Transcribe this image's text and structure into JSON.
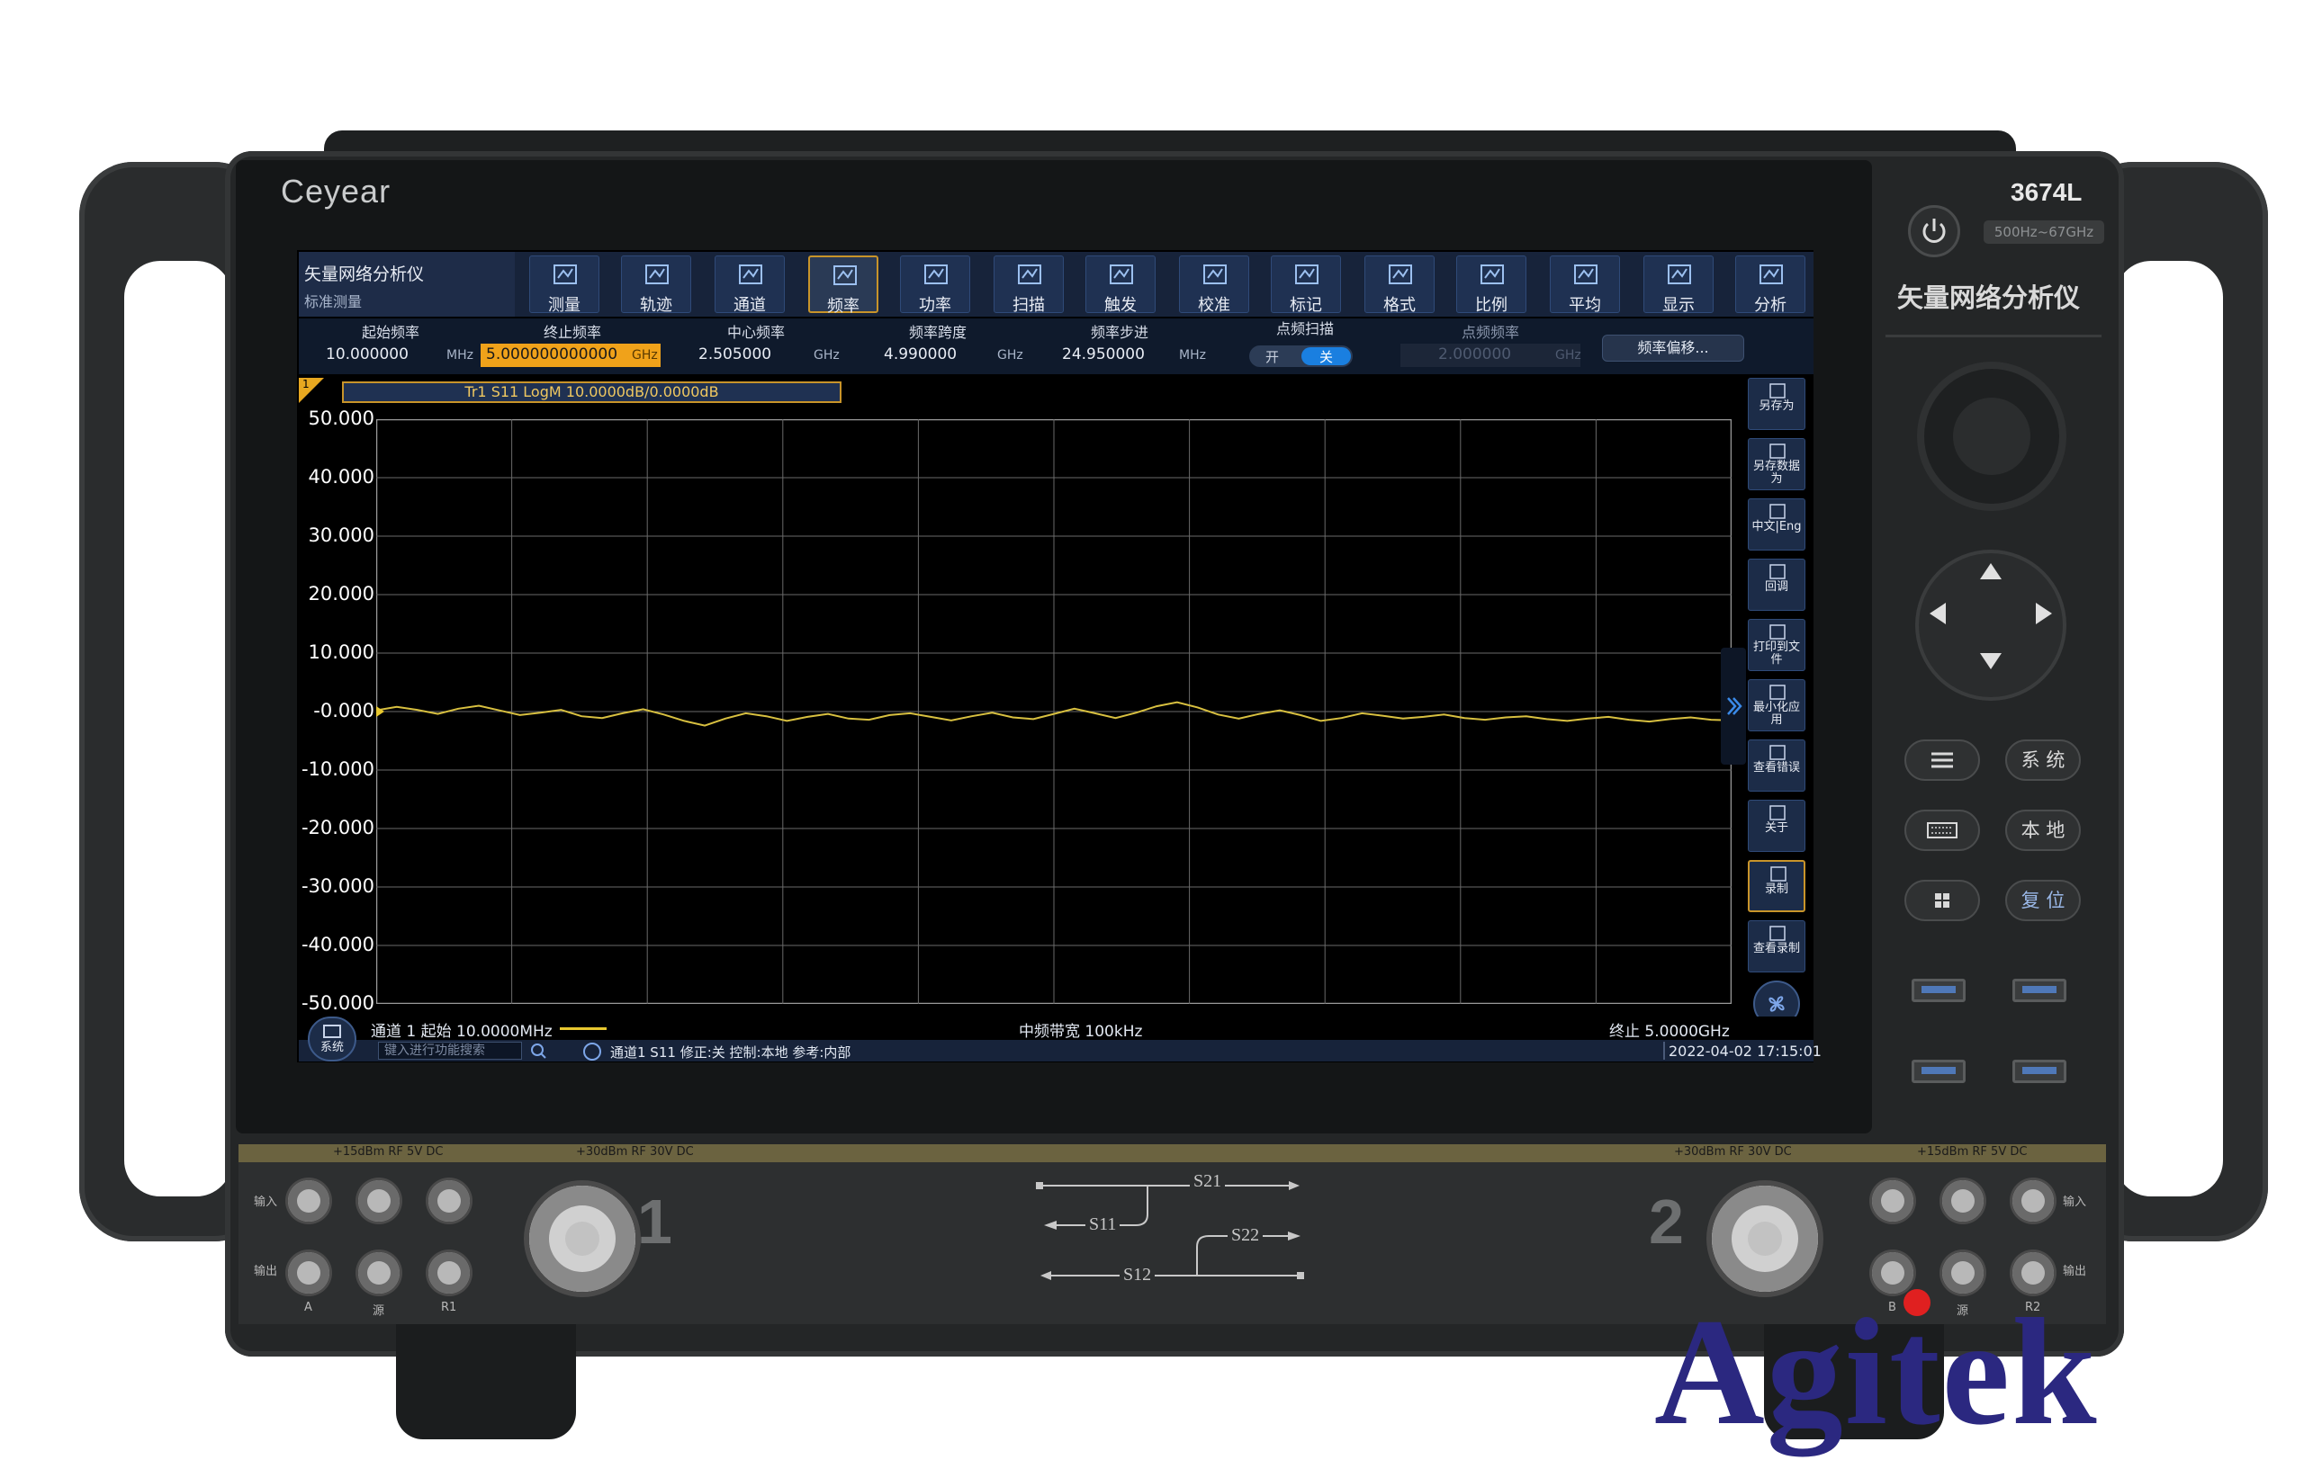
{
  "brand": "Ceyear",
  "model": "3674L",
  "frequency_range_badge": "500Hz~67GHz",
  "panel_title": "矢量网络分析仪",
  "app": {
    "title": "矢量网络分析仪",
    "subtitle": "标准测量"
  },
  "toolbar": [
    {
      "label": "测量",
      "icon": "ruler-icon"
    },
    {
      "label": "轨迹",
      "icon": "trace-icon"
    },
    {
      "label": "通道",
      "icon": "channel-icon"
    },
    {
      "label": "频率",
      "icon": "frequency-icon",
      "active": true
    },
    {
      "label": "功率",
      "icon": "power-icon"
    },
    {
      "label": "扫描",
      "icon": "sweep-icon"
    },
    {
      "label": "触发",
      "icon": "trigger-icon"
    },
    {
      "label": "校准",
      "icon": "calibration-icon"
    },
    {
      "label": "标记",
      "icon": "marker-icon"
    },
    {
      "label": "格式",
      "icon": "format-icon"
    },
    {
      "label": "比例",
      "icon": "scale-icon"
    },
    {
      "label": "平均",
      "icon": "average-icon"
    },
    {
      "label": "显示",
      "icon": "display-icon"
    },
    {
      "label": "分析",
      "icon": "analysis-icon"
    }
  ],
  "freq": {
    "start": {
      "label": "起始频率",
      "value": "10.000000",
      "unit": "MHz"
    },
    "stop": {
      "label": "终止频率",
      "value": "5.000000000000",
      "unit": "GHz"
    },
    "center": {
      "label": "中心频率",
      "value": "2.505000",
      "unit": "GHz"
    },
    "span": {
      "label": "频率跨度",
      "value": "4.990000",
      "unit": "GHz"
    },
    "step": {
      "label": "频率步进",
      "value": "24.950000",
      "unit": "MHz"
    },
    "cw_sweep": {
      "label": "点频扫描",
      "on": "开",
      "off": "关",
      "state": "off"
    },
    "cw_freq": {
      "label": "点频频率",
      "value": "2.000000",
      "unit": "GHz"
    },
    "offset_button": "频率偏移..."
  },
  "trace_label": "Tr1 S11 LogM 10.0000dB/0.0000dB",
  "channel_marker": "1",
  "y_axis": [
    "50.000",
    "40.000",
    "30.000",
    "20.000",
    "10.000",
    "-0.000",
    "-10.000",
    "-20.000",
    "-30.000",
    "-40.000",
    "-50.000"
  ],
  "chart_data": {
    "type": "line",
    "ylim": [
      -50,
      50
    ],
    "x_range_ghz": [
      0.01,
      5.0
    ],
    "y_ticks": [
      50,
      40,
      30,
      20,
      10,
      0,
      -10,
      -20,
      -30,
      -40,
      -50
    ],
    "series_color": "#d8c040",
    "series": [
      {
        "values": [
          0.2,
          0.8,
          0.3,
          -0.4,
          0.5,
          1.0,
          0.2,
          -0.6,
          -0.2,
          0.3,
          -0.8,
          -1.1,
          -0.3,
          0.4,
          -0.5,
          -1.6,
          -2.4,
          -1.2,
          -0.3,
          -0.8,
          -1.6,
          -0.9,
          -0.4,
          -1.2,
          -1.4,
          -0.6,
          -0.3,
          -0.9,
          -1.5,
          -0.8,
          -0.2,
          -1.0,
          -1.3,
          -0.4,
          0.5,
          -0.3,
          -1.1,
          -0.2,
          0.9,
          1.6,
          0.7,
          -0.5,
          -1.2,
          -0.4,
          0.2,
          -0.6,
          -1.6,
          -1.1,
          -0.3,
          -0.7,
          -1.2,
          -0.9,
          -0.5,
          -1.1,
          -1.4,
          -1.0,
          -0.8,
          -1.3,
          -1.6,
          -1.2,
          -0.9,
          -1.4,
          -1.7,
          -1.3,
          -1.0,
          -1.4,
          -1.5
        ]
      }
    ]
  },
  "bottom": {
    "left": "通道 1 起始 10.0000MHz",
    "center": "中频带宽 100kHz",
    "right": "终止 5.0000GHz"
  },
  "status": {
    "search_placeholder": "键入进行功能搜索",
    "info": "通道1 S11 修正:关 控制:本地 参考:内部",
    "datetime": "2022-04-02 17:15:01",
    "system_button": "系统"
  },
  "sidebar": [
    {
      "label": "另存为",
      "icon": "save-as-icon"
    },
    {
      "label": "另存数据为",
      "icon": "save-data-icon"
    },
    {
      "label": "中文|Eng",
      "icon": "language-icon"
    },
    {
      "label": "回调",
      "icon": "folder-icon"
    },
    {
      "label": "打印到文件",
      "icon": "print-icon"
    },
    {
      "label": "最小化应用",
      "icon": "minimize-icon"
    },
    {
      "label": "查看错误",
      "icon": "error-log-icon"
    },
    {
      "label": "关于",
      "icon": "info-icon"
    },
    {
      "label": "录制",
      "icon": "record-icon",
      "active": true
    },
    {
      "label": "查看录制",
      "icon": "view-recording-icon"
    }
  ],
  "keys": {
    "system": "系 统",
    "local": "本 地",
    "preset": "复 位"
  },
  "ports": {
    "warning_left": "+15dBm RF 5V DC",
    "warning_port1": "+30dBm RF 30V DC",
    "warning_port2": "+30dBm RF 30V DC",
    "warning_right": "+15dBm RF 5V DC",
    "in_label": "输入",
    "out_label": "输出",
    "port1": "1",
    "port2": "2",
    "jack_labels_left": [
      "A",
      "源",
      "R1"
    ],
    "jack_labels_right": [
      "B",
      "源",
      "R2"
    ],
    "s21": "S21",
    "s11": "S11",
    "s22": "S22",
    "s12": "S12"
  },
  "watermark": "Agitek"
}
